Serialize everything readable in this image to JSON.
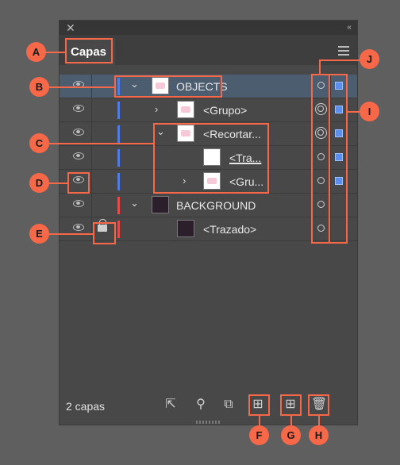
{
  "panel": {
    "title": "Capas",
    "footer_count": "2 capas"
  },
  "layers": [
    {
      "label": "OBJECTS",
      "bar_color": "#4f7de8",
      "selected": true
    },
    {
      "label": "<Grupo>",
      "bar_color": "#4f7de8"
    },
    {
      "label": "<Recortar...",
      "bar_color": "#4f7de8"
    },
    {
      "label": "<Tra...",
      "bar_color": "#4f7de8"
    },
    {
      "label": "<Gru...",
      "bar_color": "#4f7de8"
    },
    {
      "label": "BACKGROUND",
      "bar_color": "#e84a4a"
    },
    {
      "label": "<Trazado>",
      "bar_color": "#e84a4a"
    }
  ],
  "callouts": {
    "A": "A",
    "B": "B",
    "C": "C",
    "D": "D",
    "E": "E",
    "F": "F",
    "G": "G",
    "H": "H",
    "I": "I",
    "J": "J"
  },
  "icons": [
    "close-icon",
    "collapse-icon",
    "panel-menu-icon",
    "eye-icon",
    "lock-icon",
    "chevron-icon",
    "target-icon",
    "selection-square-icon",
    "export-icon",
    "search-icon",
    "clip-icon",
    "new-sublayer-icon",
    "new-layer-icon",
    "trash-icon"
  ],
  "colors": {
    "accent": "#f76848",
    "selection": "#5a8ef0"
  }
}
